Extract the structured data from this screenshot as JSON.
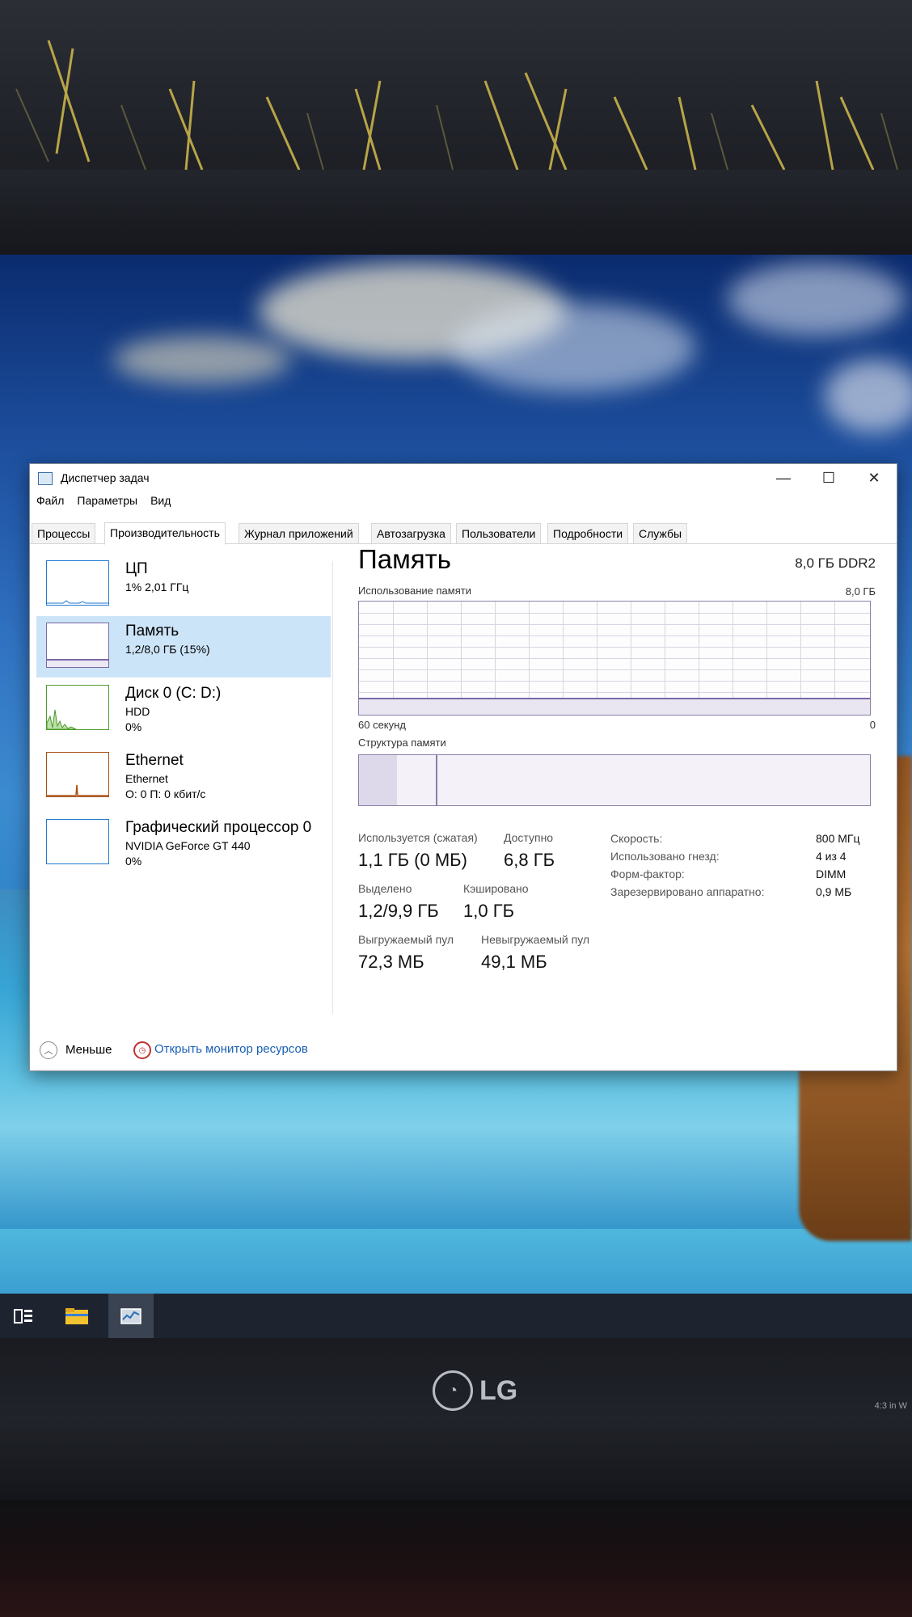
{
  "window": {
    "title": "Диспетчер задач",
    "minimize_glyph": "—",
    "maximize_glyph": "☐",
    "close_glyph": "✕"
  },
  "menu": [
    "Файл",
    "Параметры",
    "Вид"
  ],
  "tabs": [
    "Процессы",
    "Производительность",
    "Журнал приложений",
    "Автозагрузка",
    "Пользователи",
    "Подробности",
    "Службы"
  ],
  "active_tab": "Производительность",
  "devices": [
    {
      "name": "ЦП",
      "line2": "1% 2,01 ГГц",
      "line3": "",
      "color": "#1f7ad1",
      "selected": false
    },
    {
      "name": "Память",
      "line2": "1,2/8,0 ГБ (15%)",
      "line3": "",
      "color": "#7a68a8",
      "selected": true
    },
    {
      "name": "Диск 0 (C: D:)",
      "line2": "HDD",
      "line3": "0%",
      "color": "#4c9a2a",
      "selected": false
    },
    {
      "name": "Ethernet",
      "line2": "Ethernet",
      "line3": "О: 0 П: 0 кбит/с",
      "color": "#a74f10",
      "selected": false
    },
    {
      "name": "Графический процессор 0",
      "line2": "NVIDIA GeForce GT 440",
      "line3": "0%",
      "color": "#1f7ad1",
      "selected": false
    }
  ],
  "memory": {
    "title": "Память",
    "spec": "8,0 ГБ DDR2",
    "usage_label": "Использование памяти",
    "usage_max": "8,0 ГБ",
    "time_label": "60 секунд",
    "time_zero": "0",
    "structure_label": "Структура памяти",
    "usage_fraction": 0.15,
    "stats": [
      {
        "label": "Используется (сжатая)",
        "value": "1,1 ГБ (0 МБ)"
      },
      {
        "label": "Доступно",
        "value": "6,8 ГБ"
      },
      {
        "label": "Выделено",
        "value": "1,2/9,9 ГБ"
      },
      {
        "label": "Кэшировано",
        "value": "1,0 ГБ"
      },
      {
        "label": "Выгружаемый пул",
        "value": "72,3 МБ"
      },
      {
        "label": "Невыгружаемый пул",
        "value": "49,1 МБ"
      }
    ],
    "details": [
      {
        "label": "Скорость:",
        "value": "800 МГц"
      },
      {
        "label": "Использовано гнезд:",
        "value": "4 из 4"
      },
      {
        "label": "Форм-фактор:",
        "value": "DIMM"
      },
      {
        "label": "Зарезервировано аппаратно:",
        "value": "0,9 МБ"
      }
    ]
  },
  "footer": {
    "less_label": "Меньше",
    "monitor_label": "Открыть монитор ресурсов"
  },
  "taskbar": {
    "items": [
      "task-view-icon",
      "file-explorer-icon",
      "task-manager-icon"
    ]
  },
  "monitor": {
    "brand": "LG",
    "bezel_note": "4:3 in W"
  }
}
